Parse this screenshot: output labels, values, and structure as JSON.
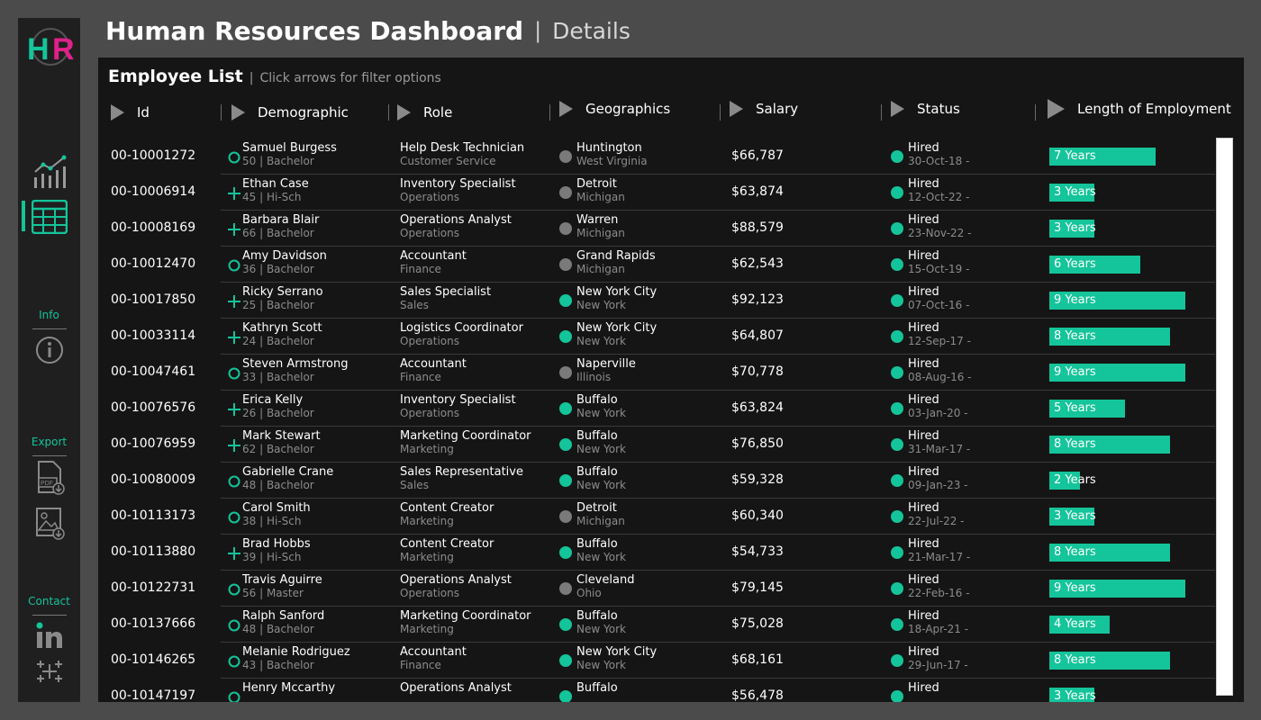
{
  "header": {
    "title": "Human Resources Dashboard",
    "separator": "|",
    "subtitle": "Details"
  },
  "colors": {
    "accent": "#14c49a",
    "logo_h": "#14c49a",
    "logo_r": "#e0218a",
    "inactive_dot": "#7a7a7a"
  },
  "sidebar": {
    "info_label": "Info",
    "export_label": "Export",
    "contact_label": "Contact",
    "icons": [
      "logo-icon",
      "line-chart-icon",
      "table-icon",
      "info-icon",
      "pdf-export-icon",
      "image-export-icon",
      "linkedin-icon",
      "tableau-icon"
    ]
  },
  "panel": {
    "title": "Employee List",
    "separator": "|",
    "hint": "Click arrows for filter options"
  },
  "columns": [
    "Id",
    "Demographic",
    "Role",
    "Geographics",
    "Salary",
    "Status",
    "Length of Employment"
  ],
  "rows": [
    {
      "id": "00-10001272",
      "name": "Samuel Burgess",
      "demo": "50 | Bachelor",
      "demo_icon": "circle",
      "role": "Help Desk Technician",
      "dept": "Customer Service",
      "city": "Huntington",
      "state": "West Virginia",
      "geo_dot": "gray",
      "salary": "$66,787",
      "status": "Hired",
      "date": "30-Oct-18 -",
      "years_label": "7 Years",
      "years": 7
    },
    {
      "id": "00-10006914",
      "name": "Ethan Case",
      "demo": "45 | Hi-Sch",
      "demo_icon": "plus",
      "role": "Inventory Specialist",
      "dept": "Operations",
      "city": "Detroit",
      "state": "Michigan",
      "geo_dot": "gray",
      "salary": "$63,874",
      "status": "Hired",
      "date": "12-Oct-22 -",
      "years_label": "3 Years",
      "years": 3
    },
    {
      "id": "00-10008169",
      "name": "Barbara Blair",
      "demo": "66 | Bachelor",
      "demo_icon": "plus",
      "role": "Operations Analyst",
      "dept": "Operations",
      "city": "Warren",
      "state": "Michigan",
      "geo_dot": "gray",
      "salary": "$88,579",
      "status": "Hired",
      "date": "23-Nov-22 -",
      "years_label": "3 Years",
      "years": 3
    },
    {
      "id": "00-10012470",
      "name": "Amy Davidson",
      "demo": "36 | Bachelor",
      "demo_icon": "circle",
      "role": "Accountant",
      "dept": "Finance",
      "city": "Grand Rapids",
      "state": "Michigan",
      "geo_dot": "gray",
      "salary": "$62,543",
      "status": "Hired",
      "date": "15-Oct-19 -",
      "years_label": "6 Years",
      "years": 6
    },
    {
      "id": "00-10017850",
      "name": "Ricky Serrano",
      "demo": "25 | Bachelor",
      "demo_icon": "plus",
      "role": "Sales Specialist",
      "dept": "Sales",
      "city": "New York City",
      "state": "New York",
      "geo_dot": "green",
      "salary": "$92,123",
      "status": "Hired",
      "date": "07-Oct-16 -",
      "years_label": "9 Years",
      "years": 9
    },
    {
      "id": "00-10033114",
      "name": "Kathryn Scott",
      "demo": "24 | Bachelor",
      "demo_icon": "plus",
      "role": "Logistics Coordinator",
      "dept": "Operations",
      "city": "New York City",
      "state": "New York",
      "geo_dot": "green",
      "salary": "$64,807",
      "status": "Hired",
      "date": "12-Sep-17 -",
      "years_label": "8 Years",
      "years": 8
    },
    {
      "id": "00-10047461",
      "name": "Steven Armstrong",
      "demo": "33 | Bachelor",
      "demo_icon": "circle",
      "role": "Accountant",
      "dept": "Finance",
      "city": "Naperville",
      "state": "Illinois",
      "geo_dot": "gray",
      "salary": "$70,778",
      "status": "Hired",
      "date": "08-Aug-16 -",
      "years_label": "9 Years",
      "years": 9
    },
    {
      "id": "00-10076576",
      "name": "Erica Kelly",
      "demo": "26 | Bachelor",
      "demo_icon": "plus",
      "role": "Inventory Specialist",
      "dept": "Operations",
      "city": "Buffalo",
      "state": "New York",
      "geo_dot": "green",
      "salary": "$63,824",
      "status": "Hired",
      "date": "03-Jan-20 -",
      "years_label": "5 Years",
      "years": 5
    },
    {
      "id": "00-10076959",
      "name": "Mark Stewart",
      "demo": "62 | Bachelor",
      "demo_icon": "plus",
      "role": "Marketing Coordinator",
      "dept": "Marketing",
      "city": "Buffalo",
      "state": "New York",
      "geo_dot": "green",
      "salary": "$76,850",
      "status": "Hired",
      "date": "31-Mar-17 -",
      "years_label": "8 Years",
      "years": 8
    },
    {
      "id": "00-10080009",
      "name": "Gabrielle Crane",
      "demo": "48 | Bachelor",
      "demo_icon": "circle",
      "role": "Sales Representative",
      "dept": "Sales",
      "city": "Buffalo",
      "state": "New York",
      "geo_dot": "green",
      "salary": "$59,328",
      "status": "Hired",
      "date": "09-Jan-23 -",
      "years_label": "2 Years",
      "years": 2
    },
    {
      "id": "00-10113173",
      "name": "Carol Smith",
      "demo": "38 | Hi-Sch",
      "demo_icon": "circle",
      "role": "Content Creator",
      "dept": "Marketing",
      "city": "Detroit",
      "state": "Michigan",
      "geo_dot": "gray",
      "salary": "$60,340",
      "status": "Hired",
      "date": "22-Jul-22 -",
      "years_label": "3 Years",
      "years": 3
    },
    {
      "id": "00-10113880",
      "name": "Brad Hobbs",
      "demo": "39 | Hi-Sch",
      "demo_icon": "plus",
      "role": "Content Creator",
      "dept": "Marketing",
      "city": "Buffalo",
      "state": "New York",
      "geo_dot": "green",
      "salary": "$54,733",
      "status": "Hired",
      "date": "21-Mar-17 -",
      "years_label": "8 Years",
      "years": 8
    },
    {
      "id": "00-10122731",
      "name": "Travis Aguirre",
      "demo": "56 | Master",
      "demo_icon": "circle",
      "role": "Operations Analyst",
      "dept": "Operations",
      "city": "Cleveland",
      "state": "Ohio",
      "geo_dot": "gray",
      "salary": "$79,145",
      "status": "Hired",
      "date": "22-Feb-16 -",
      "years_label": "9 Years",
      "years": 9
    },
    {
      "id": "00-10137666",
      "name": "Ralph Sanford",
      "demo": "48 | Bachelor",
      "demo_icon": "circle",
      "role": "Marketing Coordinator",
      "dept": "Marketing",
      "city": "Buffalo",
      "state": "New York",
      "geo_dot": "green",
      "salary": "$75,028",
      "status": "Hired",
      "date": "18-Apr-21 -",
      "years_label": "4 Years",
      "years": 4
    },
    {
      "id": "00-10146265",
      "name": "Melanie Rodriguez",
      "demo": "43 | Bachelor",
      "demo_icon": "circle",
      "role": "Accountant",
      "dept": "Finance",
      "city": "New York City",
      "state": "New York",
      "geo_dot": "green",
      "salary": "$68,161",
      "status": "Hired",
      "date": "29-Jun-17 -",
      "years_label": "8 Years",
      "years": 8
    },
    {
      "id": "00-10147197",
      "name": "Henry Mccarthy",
      "demo": "",
      "demo_icon": "circle",
      "role": "Operations Analyst",
      "dept": "",
      "city": "Buffalo",
      "state": "",
      "geo_dot": "green",
      "salary": "$56,478",
      "status": "Hired",
      "date": "",
      "years_label": "3 Years",
      "years": 3
    }
  ]
}
